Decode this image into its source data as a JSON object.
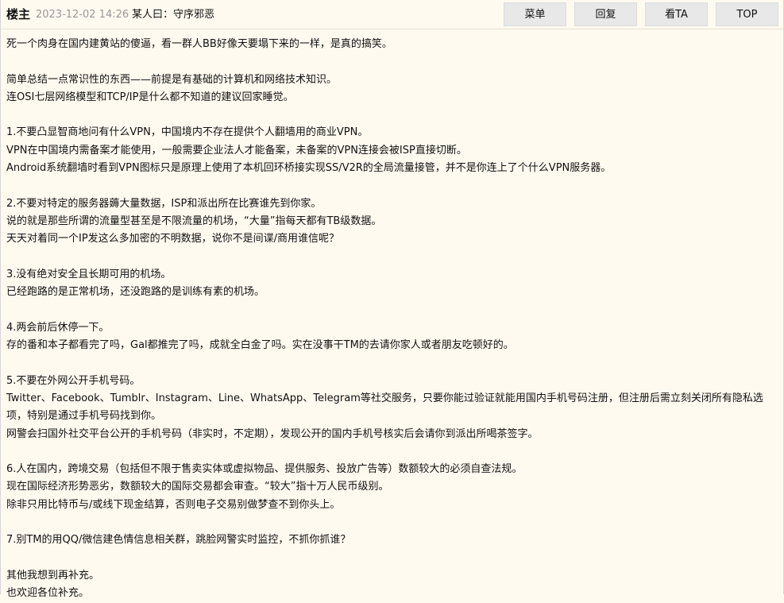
{
  "header": {
    "author": "楼主",
    "time": "2023-12-02 14:26",
    "signature": "某人曰：守序邪恶",
    "actions": [
      "菜单",
      "回复",
      "看TA",
      "TOP"
    ]
  },
  "content": [
    "死一个肉身在国内建黄站的傻逼，看一群人BB好像天要塌下来的一样，是真的搞笑。",
    "",
    "简单总结一点常识性的东西——前提是有基础的计算机和网络技术知识。",
    "连OSI七层网络模型和TCP/IP是什么都不知道的建议回家睡觉。",
    "",
    "1.不要凸显智商地问有什么VPN，中国境内不存在提供个人翻墙用的商业VPN。",
    "VPN在中国境内需备案才能使用，一般需要企业法人才能备案，未备案的VPN连接会被ISP直接切断。",
    "Android系统翻墙时看到VPN图标只是原理上使用了本机回环桥接实现SS/V2R的全局流量接管，并不是你连上了个什么VPN服务器。",
    "",
    "2.不要对特定的服务器薅大量数据，ISP和派出所在比赛谁先到你家。",
    "说的就是那些所谓的流量型甚至是不限流量的机场，“大量”指每天都有TB级数据。",
    "天天对着同一个IP发这么多加密的不明数据，说你不是间谍/商用谁信呢？",
    "",
    "3.没有绝对安全且长期可用的机场。",
    "已经跑路的是正常机场，还没跑路的是训练有素的机场。",
    "",
    "4.两会前后休停一下。",
    "存的番和本子都看完了吗，Gal都推完了吗，成就全白金了吗。实在没事干TM的去请你家人或者朋友吃顿好的。",
    "",
    "5.不要在外网公开手机号码。",
    "Twitter、Facebook、Tumblr、Instagram、Line、WhatsApp、Telegram等社交服务，只要你能过验证就能用国内手机号码注册，但注册后需立刻关闭所有隐私选项，特别是通过手机号码找到你。",
    "网警会扫国外社交平台公开的手机号码（非实时，不定期），发现公开的国内手机号核实后会请你到派出所喝茶签字。",
    "",
    "6.人在国内，跨境交易（包括但不限于售卖实体或虚拟物品、提供服务、投放广告等）数额较大的必须自查法规。",
    "现在国际经济形势恶劣，数额较大的国际交易都会审查。“较大”指十万人民币级别。",
    "除非只用比特币与/或线下现金结算，否则电子交易别做梦查不到你头上。",
    "",
    "7.别TM的用QQ/微信建色情信息相关群，跳脸网警实时监控，不抓你抓谁？",
    "",
    "其他我想到再补充。",
    "也欢迎各位补充。"
  ]
}
